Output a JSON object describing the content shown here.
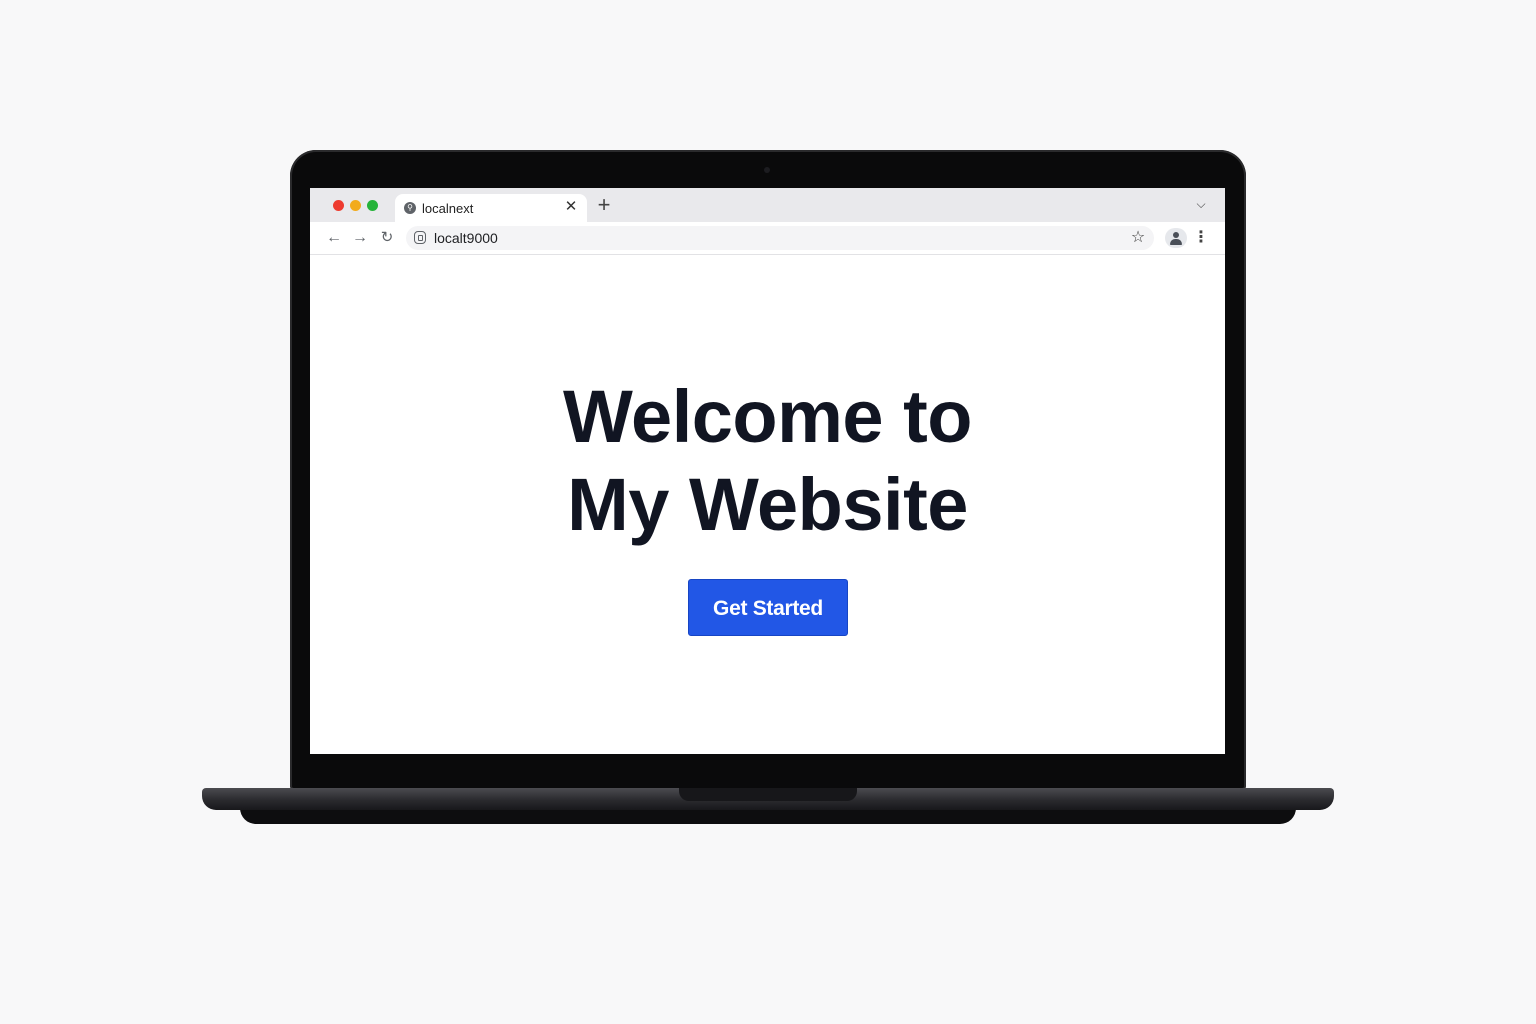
{
  "browser": {
    "tab": {
      "title": "localnext",
      "favicon_icon": "globe-icon",
      "close_icon": "close-icon"
    },
    "new_tab_icon": "plus-icon",
    "tab_list_icon": "chevron-down-icon",
    "toolbar": {
      "back_icon": "arrow-left-icon",
      "forward_icon": "arrow-right-icon",
      "reload_icon": "reload-icon",
      "url": "localt9000",
      "bookmark_icon": "star-icon",
      "profile_icon": "person-icon",
      "menu_icon": "kebab-menu-icon"
    },
    "window_controls": {
      "close_color": "#ee3b2f",
      "minimize_color": "#f2ab1c",
      "maximize_color": "#26b33a"
    }
  },
  "page": {
    "title_line1": "Welcome to",
    "title_line2": "My Website",
    "cta_label": "Get Started",
    "cta_color": "#2257e6"
  }
}
